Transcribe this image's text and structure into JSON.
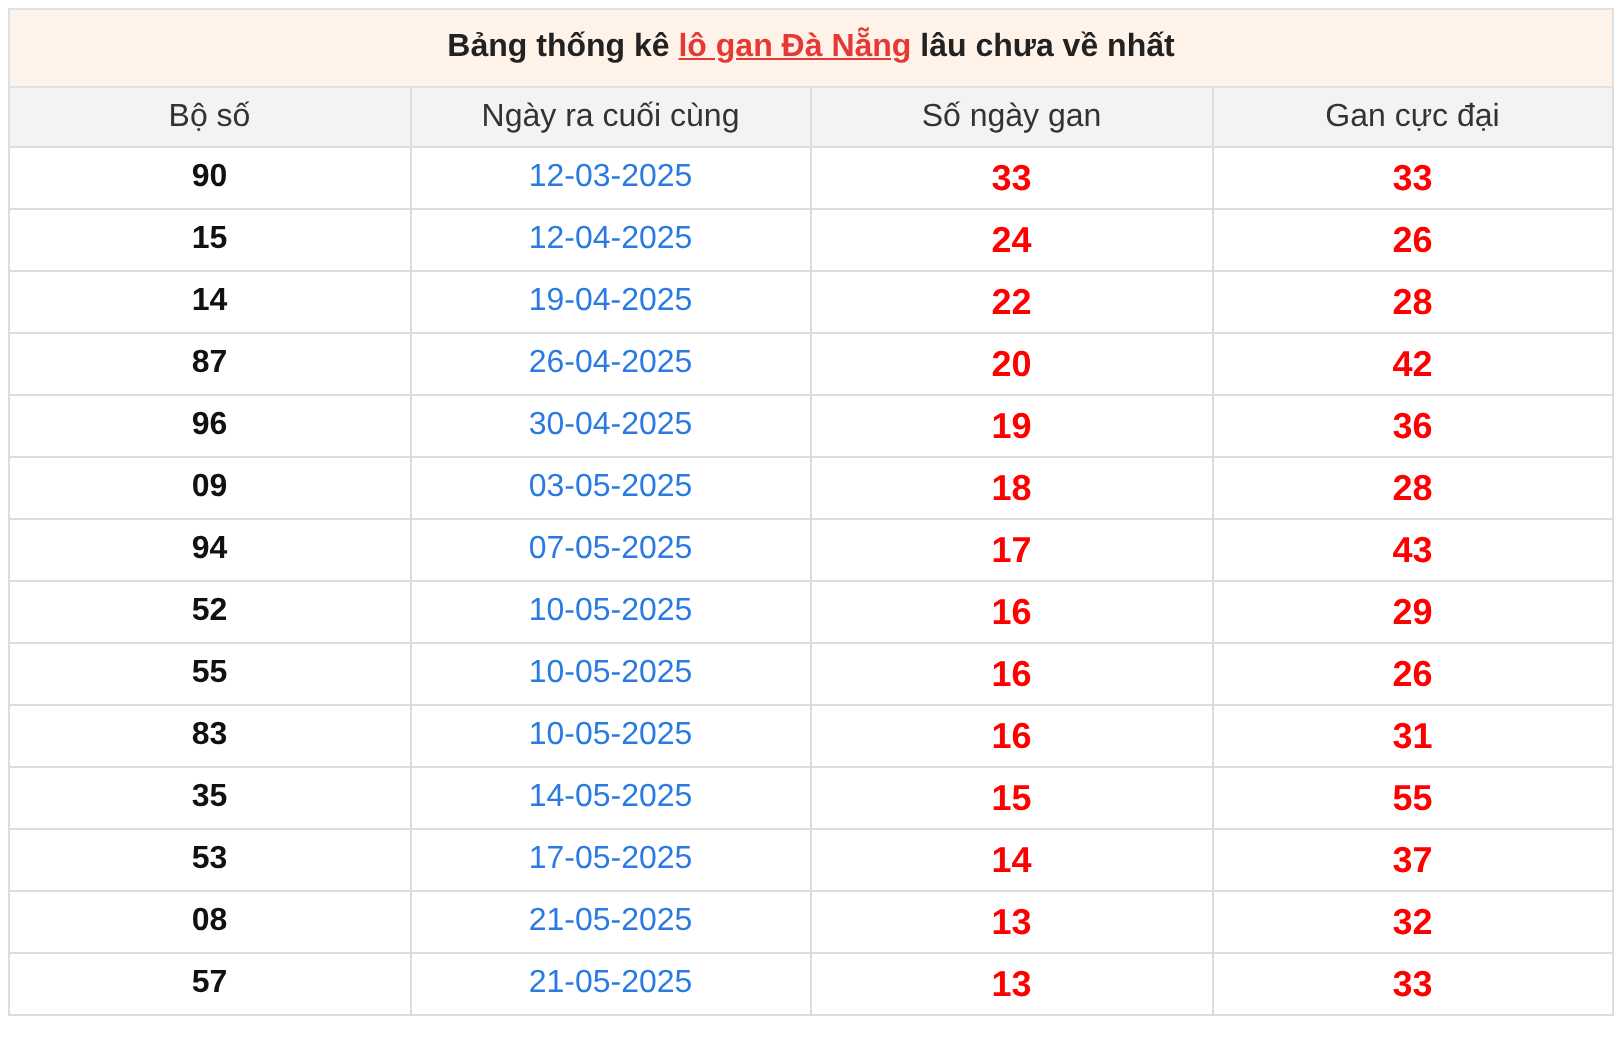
{
  "title": {
    "before": "Bảng thống kê",
    "link": "lô gan Đà Nẵng",
    "after": "lâu chưa về nhất"
  },
  "columns": [
    "Bộ số",
    "Ngày ra cuối cùng",
    "Số ngày gan",
    "Gan cực đại"
  ],
  "rows": [
    {
      "number": "90",
      "last_date": "12-03-2025",
      "days": "33",
      "max": "33"
    },
    {
      "number": "15",
      "last_date": "12-04-2025",
      "days": "24",
      "max": "26"
    },
    {
      "number": "14",
      "last_date": "19-04-2025",
      "days": "22",
      "max": "28"
    },
    {
      "number": "87",
      "last_date": "26-04-2025",
      "days": "20",
      "max": "42"
    },
    {
      "number": "96",
      "last_date": "30-04-2025",
      "days": "19",
      "max": "36"
    },
    {
      "number": "09",
      "last_date": "03-05-2025",
      "days": "18",
      "max": "28"
    },
    {
      "number": "94",
      "last_date": "07-05-2025",
      "days": "17",
      "max": "43"
    },
    {
      "number": "52",
      "last_date": "10-05-2025",
      "days": "16",
      "max": "29"
    },
    {
      "number": "55",
      "last_date": "10-05-2025",
      "days": "16",
      "max": "26"
    },
    {
      "number": "83",
      "last_date": "10-05-2025",
      "days": "16",
      "max": "31"
    },
    {
      "number": "35",
      "last_date": "14-05-2025",
      "days": "15",
      "max": "55"
    },
    {
      "number": "53",
      "last_date": "17-05-2025",
      "days": "14",
      "max": "37"
    },
    {
      "number": "08",
      "last_date": "21-05-2025",
      "days": "13",
      "max": "32"
    },
    {
      "number": "57",
      "last_date": "21-05-2025",
      "days": "13",
      "max": "33"
    }
  ]
}
